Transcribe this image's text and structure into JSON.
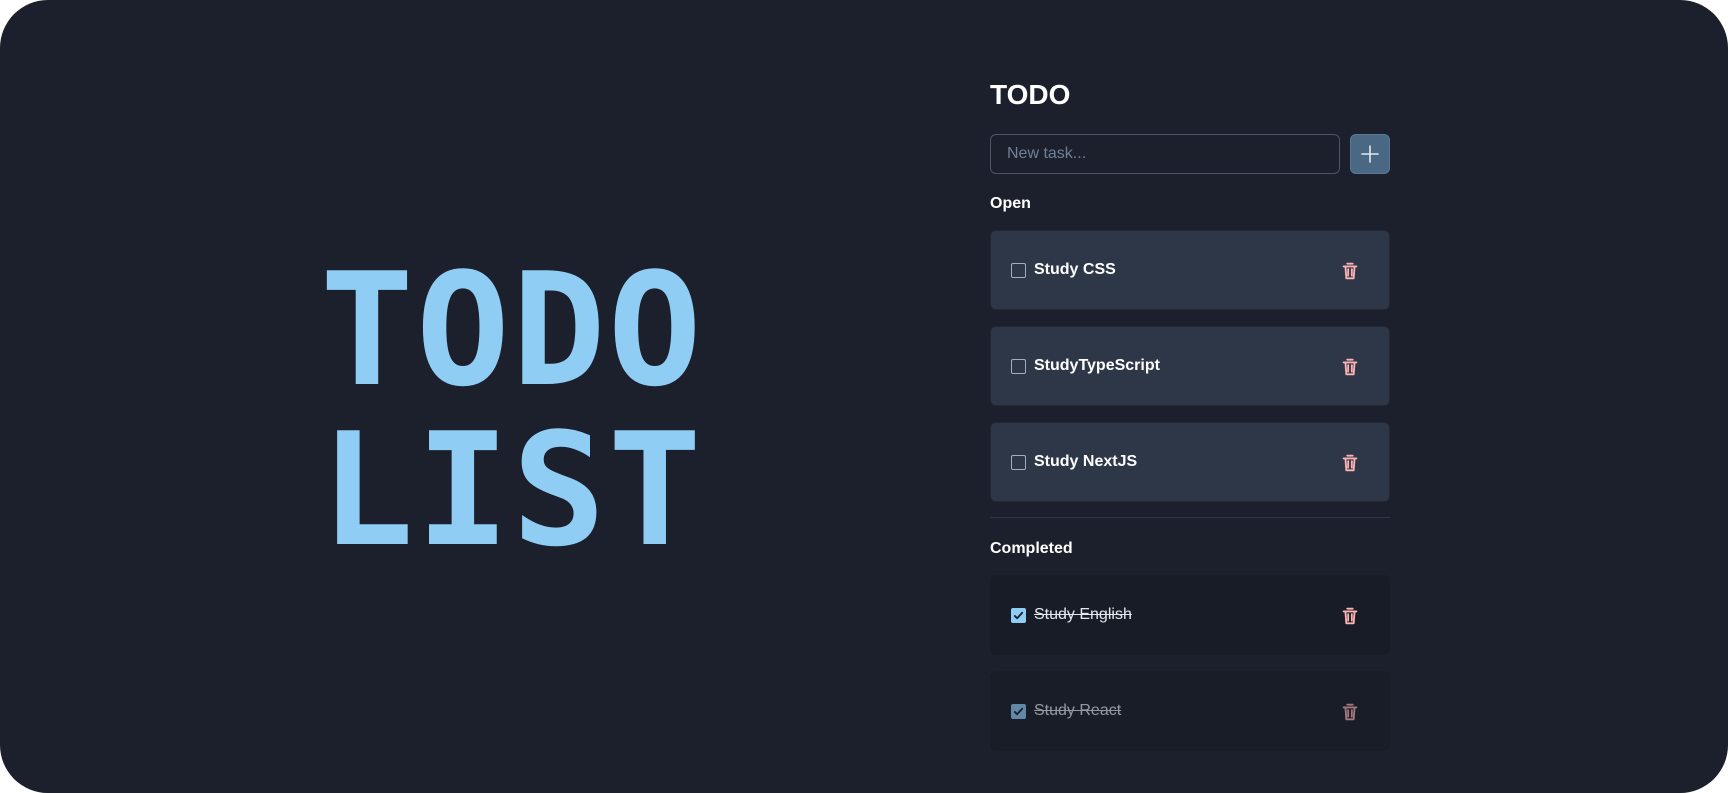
{
  "hero": {
    "line1": "TODO",
    "line2": "LIST"
  },
  "panel": {
    "title": "TODO",
    "new_task_placeholder": "New task...",
    "add_icon": "plus-icon",
    "delete_icon": "trash-icon"
  },
  "open": {
    "heading": "Open",
    "tasks": [
      {
        "label": "Study CSS",
        "checked": false
      },
      {
        "label": "StudyTypeScript",
        "checked": false
      },
      {
        "label": "Study NextJS",
        "checked": false
      }
    ]
  },
  "completed": {
    "heading": "Completed",
    "tasks": [
      {
        "label": "Study English",
        "checked": true
      },
      {
        "label": "Study React",
        "checked": true
      }
    ]
  },
  "colors": {
    "background": "#1b202c",
    "accent": "#90cdf4",
    "card": "#2d3748",
    "completed_card": "#181c26",
    "delete": "#feb2b2",
    "add_button": "#4a6784"
  }
}
